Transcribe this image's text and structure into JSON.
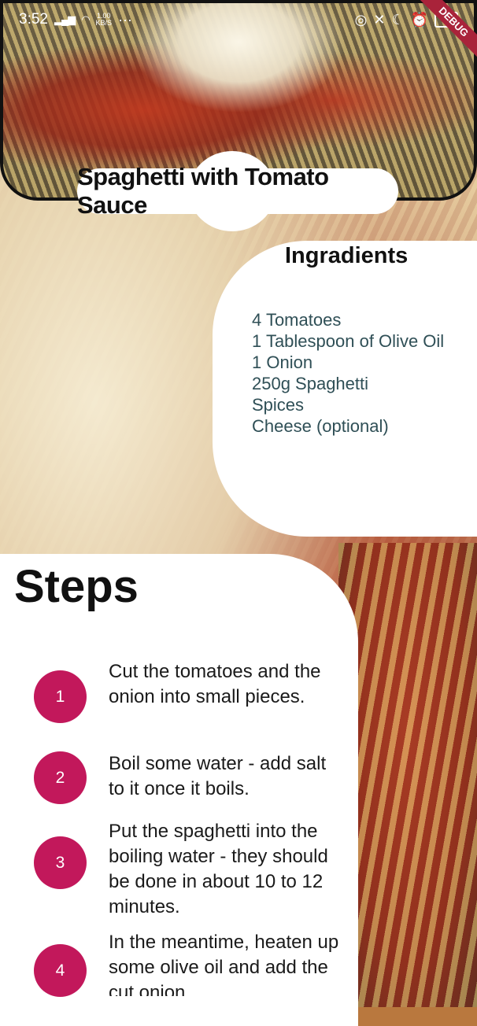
{
  "status_bar": {
    "time": "3:52",
    "network_speed_value": "1.00",
    "network_speed_unit": "KB/S",
    "battery": "50",
    "debug_label": "DEBUG"
  },
  "recipe": {
    "title": "Spaghetti with Tomato Sauce"
  },
  "ingredients": {
    "heading": "Ingradients",
    "items": [
      "4 Tomatoes",
      "1 Tablespoon of Olive Oil",
      "1 Onion",
      "250g Spaghetti",
      "Spices",
      "Cheese (optional)"
    ]
  },
  "steps": {
    "heading": "Steps",
    "items": [
      {
        "number": "1",
        "text": "Cut the tomatoes and the onion into small pieces."
      },
      {
        "number": "2",
        "text": "Boil some water - add salt to it once it boils."
      },
      {
        "number": "3",
        "text": "Put the spaghetti into the boiling water - they should be done in about 10 to 12 minutes."
      },
      {
        "number": "4",
        "text": "In the meantime, heaten up some olive oil and add the cut onion."
      }
    ]
  },
  "colors": {
    "step_circle": "#c2185b",
    "ingredient_text": "#2f4f56"
  }
}
